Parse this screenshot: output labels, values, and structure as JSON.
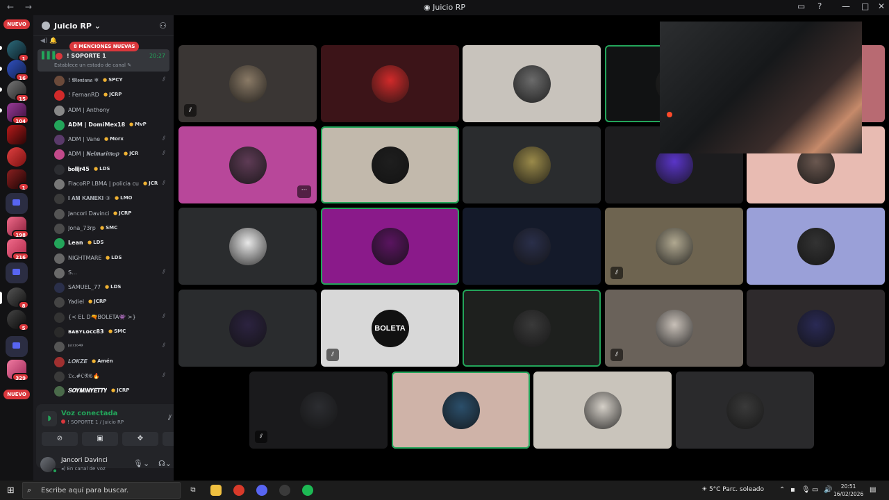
{
  "window": {
    "title": "Juicio RP",
    "nav_back": "←",
    "nav_forward": "→"
  },
  "servers": {
    "nuevo_top": "NUEVO",
    "nuevo_bottom": "NUEVO",
    "badges": [
      "1",
      "16",
      "15",
      "104",
      "1",
      "198",
      "216",
      "8",
      "5",
      "329"
    ]
  },
  "channel_sidebar": {
    "guild_name": "Juicio RP",
    "mentions_pill": "8 MENCIONES NUEVAS",
    "prev_row": "🔔",
    "voice_channel": {
      "name": "! SOPORTE 1",
      "time": "20:27",
      "status": "Establece un estado de canal"
    },
    "members": [
      {
        "name": "! 𝕸𝖔𝖓𝖙𝖆𝖓𝖆 ❄",
        "tag": "SPCY",
        "muted": true
      },
      {
        "name": "! FernanRD",
        "tag": "JCRP",
        "muted": false
      },
      {
        "name": "ADM | Anthony",
        "tag": "",
        "muted": false
      },
      {
        "name": "ADM | DomiMex18",
        "tag": "MvP",
        "muted": false,
        "bold": true
      },
      {
        "name": "ADM | Vane",
        "tag": "Morx",
        "muted": true
      },
      {
        "name": "ADM | 𝑵𝒆𝒍𝒎𝒂𝒓𝒊𝒎𝒐𝒑",
        "tag": "JCR",
        "muted": true
      },
      {
        "name": "𝐛𝐨𝐥𝐢𝐣𝐫45",
        "tag": "LDS",
        "muted": false,
        "bold": true
      },
      {
        "name": "FlacoRP LBMA | policia cu",
        "tag": "JCR",
        "muted": true
      },
      {
        "name": "𝐈 𝐀𝐌 𝐊𝐀𝐍𝐄𝐊𝐈 ③",
        "tag": "LMO",
        "muted": false
      },
      {
        "name": "Jancori Davinci",
        "tag": "JCRP",
        "muted": false
      },
      {
        "name": "Jona_73rp",
        "tag": "SMC",
        "muted": false
      },
      {
        "name": "Lean",
        "tag": "LDS",
        "muted": false,
        "bold": true
      },
      {
        "name": "NIGHTMARE",
        "tag": "LDS",
        "muted": false
      },
      {
        "name": "S...",
        "tag": "",
        "muted": true
      },
      {
        "name": "SAMUEL_77",
        "tag": "LDS",
        "muted": false
      },
      {
        "name": "Yadiel",
        "tag": "JCRP",
        "muted": false
      },
      {
        "name": "{< EL D🔫BOLETA👾 >}",
        "tag": "",
        "muted": true
      },
      {
        "name": "ʙᴀʙʏʟᴏᴄᴄ83",
        "tag": "SMC",
        "muted": false,
        "bold": true
      },
      {
        "name": "ʲᵘᶦᶜᶦᵒ⁴⁹",
        "tag": "",
        "muted": true
      },
      {
        "name": "𝑳𝑶𝑲𝒁𝑬",
        "tag": "Amén",
        "muted": false
      },
      {
        "name": "𝔇𝔢.#𝔒𝔑𝔊🔥",
        "tag": "",
        "muted": true
      },
      {
        "name": "𝑺𝑶𝒀𝑴𝑰𝑵𝒀𝑬𝑻𝑻𝒀",
        "tag": "JCRP",
        "muted": false,
        "bold": true
      }
    ]
  },
  "voice_panel": {
    "title": "Voz conectada",
    "subtitle": "! SOPORTE 1 / Juicio RP"
  },
  "user_panel": {
    "name": "Jancori Davinci",
    "status": "En canal de voz"
  },
  "stage": {
    "tiles": [
      {
        "bg": "#3a3634",
        "av": "#8a7a66",
        "muted": true
      },
      {
        "bg": "#3c1418",
        "av": "#d12a2a"
      },
      {
        "bg": "#c8c3bc",
        "av": "#6b6b6b"
      },
      {
        "bg": "#111213",
        "av": "#222",
        "speaking": true
      },
      {
        "bg": "#b86a72",
        "av": "#b86a72"
      },
      {
        "bg": "#b8479a",
        "av": "#5e3b55",
        "more": true
      },
      {
        "bg": "#c2b9ac",
        "av": "#1e1e1e",
        "speaking": true
      },
      {
        "bg": "#2a2c2e",
        "av": "#9a8a4a"
      },
      {
        "bg": "#1c1c1e",
        "av": "#5a35c8"
      },
      {
        "bg": "#e8bbb2",
        "av": "#6b5850"
      },
      {
        "bg": "#2a2c2e",
        "av": "#e8e8e8"
      },
      {
        "bg": "#8a1a8a",
        "av": "#5a1460",
        "speaking": true
      },
      {
        "bg": "#141a2a",
        "av": "#2a2f4a"
      },
      {
        "bg": "#6e6450",
        "av": "#b0a890",
        "muted": true
      },
      {
        "bg": "#9aa0d8",
        "av": "#333"
      },
      {
        "bg": "#2a2c2e",
        "av": "#2c2340"
      },
      {
        "bg": "#d8d8d8",
        "av": "#111",
        "boleta": "BOLETA",
        "muted": true
      },
      {
        "bg": "#1e201e",
        "av": "#3a3a3a",
        "speaking": true
      },
      {
        "bg": "#6a625a",
        "av": "#c8c0b8",
        "muted": true
      },
      {
        "bg": "#2e2a2c",
        "av": "#2a2a55"
      },
      {
        "bg": "#1a1a1c",
        "av": "#2c2d31",
        "muted": true
      },
      {
        "bg": "#cfb3a8",
        "av": "#2b4f6b",
        "speaking": true
      },
      {
        "bg": "#c9c4bb",
        "av": "#d5d0c8"
      },
      {
        "bg": "#2a2a2c",
        "av": "#3a3a3a"
      }
    ]
  },
  "taskbar": {
    "search_placeholder": "Escribe aquí para buscar.",
    "weather": "5°C  Parc. soleado",
    "time": "20:51",
    "date": "16/02/2026"
  }
}
